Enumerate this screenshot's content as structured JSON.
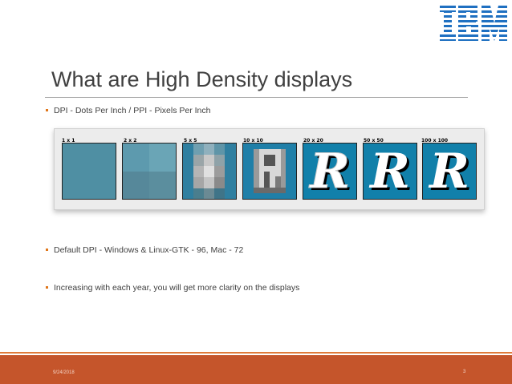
{
  "header": {
    "logo_text": "IBM",
    "logo_color": "#1f70c1"
  },
  "slide": {
    "title": "What are High Density displays",
    "bullets": [
      "DPI - Dots Per Inch / PPI - Pixels Per Inch",
      "Default DPI - Windows & Linux-GTK - 96, Mac - 72",
      "Increasing with each year, you will get more clarity on the displays"
    ],
    "bullet_color": "#e0761a"
  },
  "figure": {
    "tiles": [
      {
        "label": "1 x 1"
      },
      {
        "label": "2 x 2"
      },
      {
        "label": "5 x 5"
      },
      {
        "label": "10 x 10"
      },
      {
        "label": "20 x 20"
      },
      {
        "label": "50 x 50"
      },
      {
        "label": "100 x 100"
      }
    ],
    "tile_color": "#4f8fa3",
    "glyph": "R"
  },
  "footer": {
    "date": "9/24/2018",
    "page_number": "3",
    "color": "#c5552b"
  }
}
